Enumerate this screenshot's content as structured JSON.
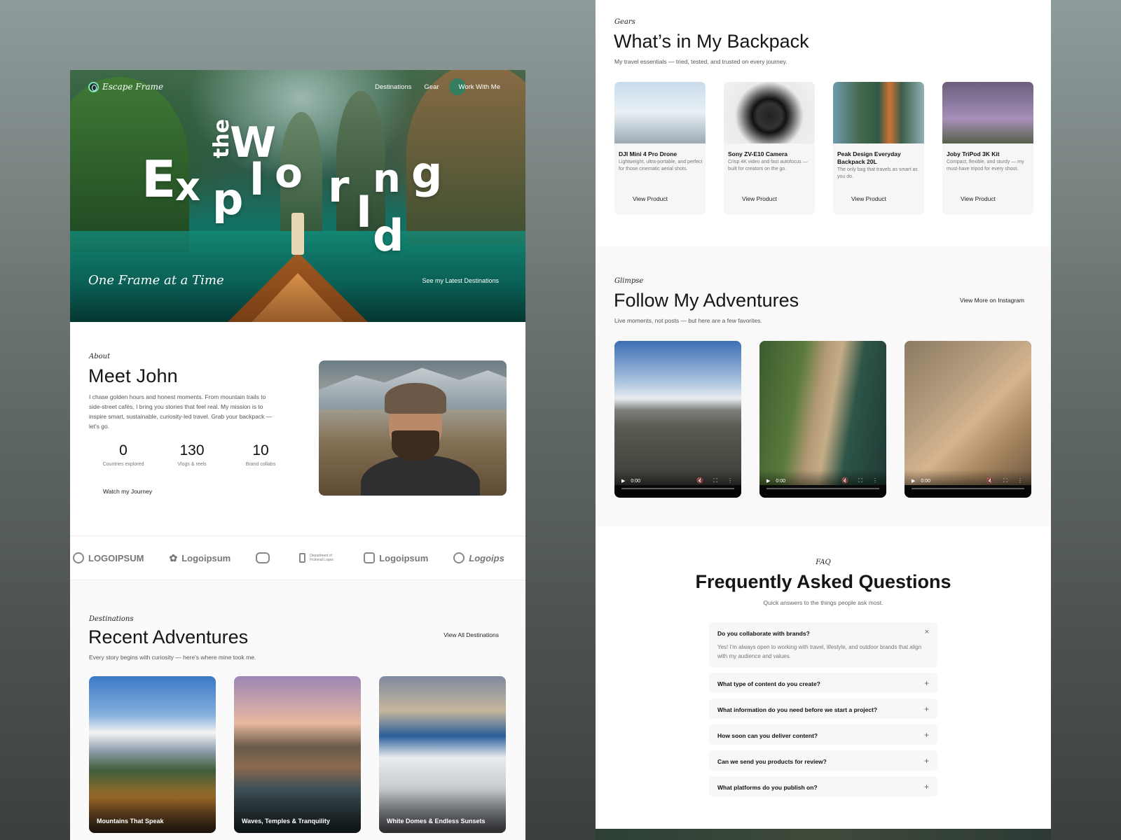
{
  "hero": {
    "brand": "Escape Frame",
    "nav": [
      "Destinations",
      "Gear",
      "Work With Me"
    ],
    "letters": [
      "the",
      "W",
      "E",
      "x",
      "p",
      "l",
      "o",
      "r",
      "I",
      "n",
      "g",
      "d"
    ],
    "tagline": "One Frame at a Time",
    "cta": "See my Latest Destinations"
  },
  "about": {
    "eyebrow": "About",
    "title": "Meet John",
    "body": "I chase golden hours and honest moments. From mountain trails to side-street cafés, I bring you stories that feel real. My mission is to inspire smart, sustainable, curiosity-led travel. Grab your backpack — let's go.",
    "stats": [
      {
        "value": "0",
        "label": "Countries explored"
      },
      {
        "value": "130",
        "label": "Vlogs & reels"
      },
      {
        "value": "10",
        "label": "Brand collabs"
      }
    ],
    "cta": "Watch my Journey"
  },
  "logos": [
    "LOGOIPSUM",
    "Logoipsum",
    "",
    "Department of Fictional Logos",
    "Logoipsum",
    "Logoips"
  ],
  "recent": {
    "eyebrow": "Destinations",
    "title": "Recent Adventures",
    "sub": "Every story begins with curiosity — here's where mine took me.",
    "cta": "View All Destinations",
    "cards": [
      "Mountains That Speak",
      "Waves, Temples & Tranquility",
      "White Domes & Endless Sunsets"
    ]
  },
  "gears": {
    "eyebrow": "Gears",
    "title": "What’s in My Backpack",
    "sub": "My travel essentials — tried, tested, and trusted on every journey.",
    "products": [
      {
        "name": "DJI Mini 4 Pro Drone",
        "desc": "Lightweight, ultra-portable, and perfect for those cinematic aerial shots.",
        "cta": "View Product"
      },
      {
        "name": "Sony ZV-E10 Camera",
        "desc": "Crisp 4K video and fast autofocus — built for creators on the go.",
        "cta": "View Product"
      },
      {
        "name": "Peak Design Everyday Backpack 20L",
        "desc": "The only bag that travels as smart as you do.",
        "cta": "View Product"
      },
      {
        "name": "Joby TriPod 3K Kit",
        "desc": "Compact, flexible, and sturdy — my must-have tripod for every shoot.",
        "cta": "View Product"
      }
    ]
  },
  "glimpse": {
    "eyebrow": "Glimpse",
    "title": "Follow My Adventures",
    "sub": "Live moments, not posts — but here are a few favorites.",
    "cta": "View More on Instagram",
    "videos": [
      {
        "time": "0:00"
      },
      {
        "time": "0:00"
      },
      {
        "time": "0:00"
      }
    ]
  },
  "faq": {
    "eyebrow": "FAQ",
    "title": "Frequently Asked Questions",
    "sub": "Quick answers to the things people ask most.",
    "items": [
      {
        "q": "Do you collaborate with brands?",
        "a": "Yes! I'm always open to working with travel, lifestyle, and outdoor brands that align with my audience and values.",
        "open": true
      },
      {
        "q": "What type of content do you create?",
        "open": false
      },
      {
        "q": "What information do you need before we start a project?",
        "open": false
      },
      {
        "q": "How soon can you deliver content?",
        "open": false
      },
      {
        "q": "Can we send you products for review?",
        "open": false
      },
      {
        "q": "What platforms do you publish on?",
        "open": false
      }
    ]
  },
  "colors": {
    "accent": "#7ee3b9",
    "dark": "#161616"
  }
}
